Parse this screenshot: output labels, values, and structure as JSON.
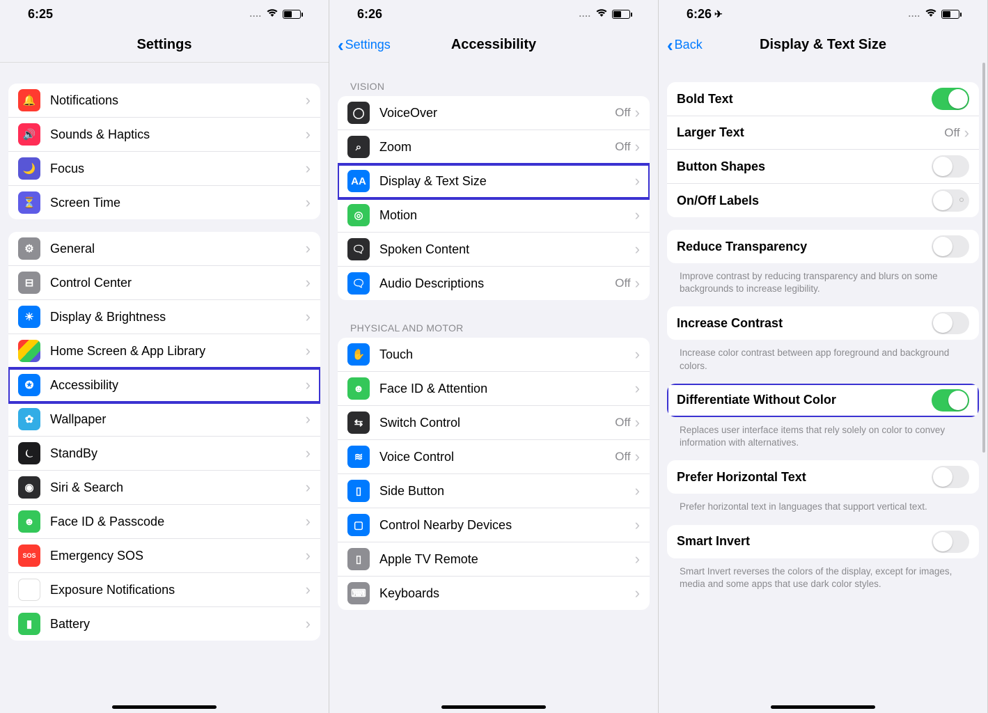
{
  "screens": [
    {
      "time": "6:25",
      "has_location": false,
      "nav": {
        "back": null,
        "title": "Settings"
      },
      "groups": [
        {
          "header": null,
          "rows": [
            {
              "icon": "notifications-icon",
              "icon_class": "i-red",
              "glyph": "🔔",
              "label": "Notifications",
              "highlight": false
            },
            {
              "icon": "sounds-icon",
              "icon_class": "i-pink",
              "glyph": "🔊",
              "label": "Sounds & Haptics",
              "highlight": false
            },
            {
              "icon": "focus-icon",
              "icon_class": "i-purple",
              "glyph": "🌙",
              "label": "Focus",
              "highlight": false
            },
            {
              "icon": "screentime-icon",
              "icon_class": "i-indigo",
              "glyph": "⏳",
              "label": "Screen Time",
              "highlight": false
            }
          ]
        },
        {
          "header": null,
          "rows": [
            {
              "icon": "general-icon",
              "icon_class": "i-gray",
              "glyph": "⚙︎",
              "label": "General",
              "highlight": false
            },
            {
              "icon": "control-center-icon",
              "icon_class": "i-gray",
              "glyph": "⊟",
              "label": "Control Center",
              "highlight": false
            },
            {
              "icon": "display-brightness-icon",
              "icon_class": "i-blue",
              "glyph": "☀︎",
              "label": "Display & Brightness",
              "highlight": false
            },
            {
              "icon": "home-screen-icon",
              "icon_class": "i-mix",
              "glyph": "",
              "label": "Home Screen & App Library",
              "highlight": false
            },
            {
              "icon": "accessibility-icon",
              "icon_class": "i-blue",
              "glyph": "✪",
              "label": "Accessibility",
              "highlight": true
            },
            {
              "icon": "wallpaper-icon",
              "icon_class": "i-cyan",
              "glyph": "✿",
              "label": "Wallpaper",
              "highlight": false
            },
            {
              "icon": "standby-icon",
              "icon_class": "i-black",
              "glyph": "⏾",
              "label": "StandBy",
              "highlight": false
            },
            {
              "icon": "siri-icon",
              "icon_class": "i-dark",
              "glyph": "◉",
              "label": "Siri & Search",
              "highlight": false
            },
            {
              "icon": "faceid-passcode-icon",
              "icon_class": "i-green",
              "glyph": "☻",
              "label": "Face ID & Passcode",
              "highlight": false
            },
            {
              "icon": "emergency-sos-icon",
              "icon_class": "i-red",
              "glyph": "SOS",
              "label": "Emergency SOS",
              "highlight": false
            },
            {
              "icon": "exposure-icon",
              "icon_class": "i-white",
              "glyph": "⟳",
              "label": "Exposure Notifications",
              "highlight": false
            },
            {
              "icon": "battery-icon",
              "icon_class": "i-green",
              "glyph": "▮",
              "label": "Battery",
              "highlight": false
            }
          ]
        }
      ],
      "home_indicator": true
    },
    {
      "time": "6:26",
      "has_location": false,
      "nav": {
        "back": "Settings",
        "title": "Accessibility"
      },
      "groups": [
        {
          "header": "VISION",
          "rows": [
            {
              "icon": "voiceover-icon",
              "icon_class": "i-dark",
              "glyph": "◯",
              "label": "VoiceOver",
              "value": "Off",
              "highlight": false
            },
            {
              "icon": "zoom-icon",
              "icon_class": "i-dark",
              "glyph": "⌕",
              "label": "Zoom",
              "value": "Off",
              "highlight": false
            },
            {
              "icon": "display-text-icon",
              "icon_class": "i-blue",
              "glyph": "AA",
              "label": "Display & Text Size",
              "highlight": true
            },
            {
              "icon": "motion-icon",
              "icon_class": "i-green",
              "glyph": "◎",
              "label": "Motion",
              "highlight": false
            },
            {
              "icon": "spoken-content-icon",
              "icon_class": "i-dark",
              "glyph": "🗨",
              "label": "Spoken Content",
              "highlight": false
            },
            {
              "icon": "audio-descriptions-icon",
              "icon_class": "i-blue",
              "glyph": "🗨",
              "label": "Audio Descriptions",
              "value": "Off",
              "highlight": false
            }
          ]
        },
        {
          "header": "PHYSICAL AND MOTOR",
          "rows": [
            {
              "icon": "touch-icon",
              "icon_class": "i-blue",
              "glyph": "✋",
              "label": "Touch",
              "highlight": false
            },
            {
              "icon": "faceid-attention-icon",
              "icon_class": "i-green",
              "glyph": "☻",
              "label": "Face ID & Attention",
              "highlight": false
            },
            {
              "icon": "switch-control-icon",
              "icon_class": "i-dark",
              "glyph": "⇆",
              "label": "Switch Control",
              "value": "Off",
              "highlight": false
            },
            {
              "icon": "voice-control-icon",
              "icon_class": "i-blue",
              "glyph": "≋",
              "label": "Voice Control",
              "value": "Off",
              "highlight": false
            },
            {
              "icon": "side-button-icon",
              "icon_class": "i-blue",
              "glyph": "▯",
              "label": "Side Button",
              "highlight": false
            },
            {
              "icon": "nearby-devices-icon",
              "icon_class": "i-blue",
              "glyph": "▢",
              "label": "Control Nearby Devices",
              "highlight": false
            },
            {
              "icon": "apple-tv-remote-icon",
              "icon_class": "i-gray",
              "glyph": "▯",
              "label": "Apple TV Remote",
              "highlight": false
            },
            {
              "icon": "keyboards-icon",
              "icon_class": "i-gray",
              "glyph": "⌨",
              "label": "Keyboards",
              "highlight": false
            }
          ]
        }
      ],
      "home_indicator": true
    },
    {
      "time": "6:26",
      "has_location": true,
      "nav": {
        "back": "Back",
        "title": "Display & Text Size"
      },
      "scroll_indicator": true,
      "toggle_groups": [
        {
          "rows": [
            {
              "label": "Bold Text",
              "type": "toggle",
              "on": true
            },
            {
              "label": "Larger Text",
              "type": "link",
              "value": "Off"
            },
            {
              "label": "Button Shapes",
              "type": "toggle",
              "on": false
            },
            {
              "label": "On/Off Labels",
              "type": "toggle",
              "on": false,
              "dot": true
            }
          ]
        },
        {
          "rows": [
            {
              "label": "Reduce Transparency",
              "type": "toggle",
              "on": false
            }
          ],
          "footer": "Improve contrast by reducing transparency and blurs on some backgrounds to increase legibility."
        },
        {
          "rows": [
            {
              "label": "Increase Contrast",
              "type": "toggle",
              "on": false
            }
          ],
          "footer": "Increase color contrast between app foreground and background colors."
        },
        {
          "rows": [
            {
              "label": "Differentiate Without Color",
              "type": "toggle",
              "on": true,
              "highlight": true
            }
          ],
          "footer": "Replaces user interface items that rely solely on color to convey information with alternatives."
        },
        {
          "rows": [
            {
              "label": "Prefer Horizontal Text",
              "type": "toggle",
              "on": false
            }
          ],
          "footer": "Prefer horizontal text in languages that support vertical text."
        },
        {
          "rows": [
            {
              "label": "Smart Invert",
              "type": "toggle",
              "on": false
            }
          ],
          "footer": "Smart Invert reverses the colors of the display, except for images, media and some apps that use dark color styles."
        }
      ],
      "home_indicator": true
    }
  ]
}
